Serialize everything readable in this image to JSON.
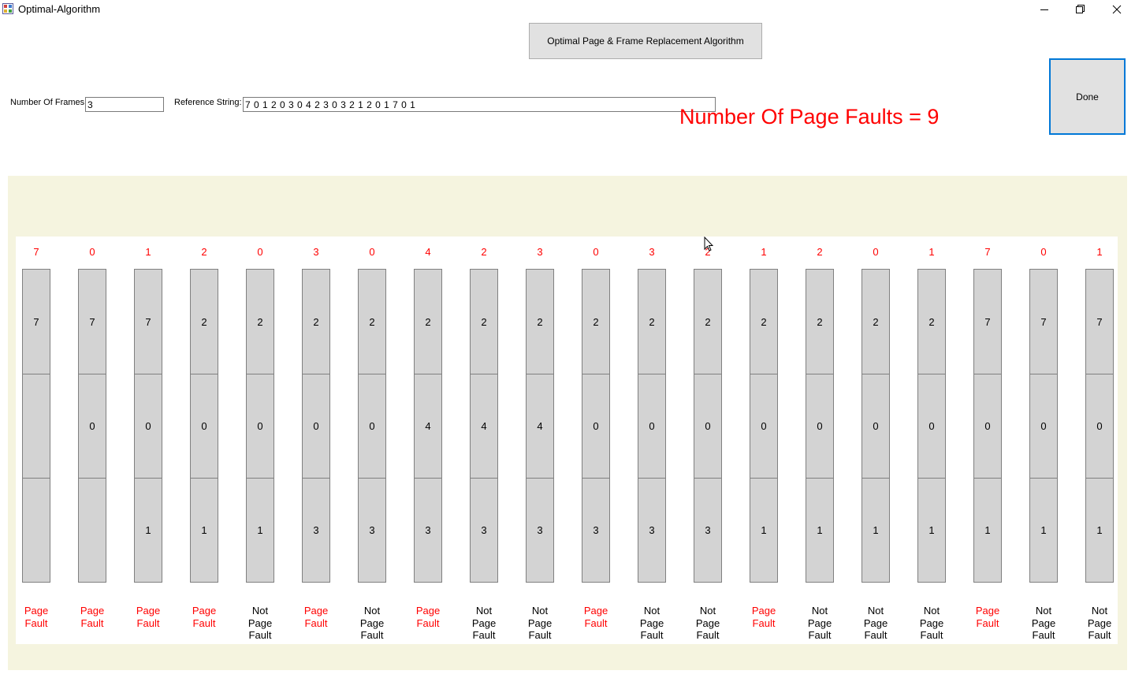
{
  "window": {
    "title": "Optimal-Algorithm"
  },
  "header": {
    "button_label": "Optimal Page & Frame Replacement Algorithm"
  },
  "inputs": {
    "frames_label": "Number Of Frames:",
    "frames_value": "3",
    "ref_label": "Reference String:",
    "ref_value": "7 0 1 2 0 3 0 4 2 3 0 3 2 1 2 0 1 7 0 1"
  },
  "done_label": "Done",
  "faults_text": "Number Of Page Faults = 9",
  "colors": {
    "fault": "#ff0000",
    "hit": "#000000",
    "panel_bg": "#f5f4df",
    "frame_bg": "#d3d3d3",
    "accent": "#0078d7"
  },
  "columns": [
    {
      "ref": "7",
      "frames": [
        "7",
        "",
        ""
      ],
      "status": "Page\nFault",
      "fault": true
    },
    {
      "ref": "0",
      "frames": [
        "7",
        "0",
        ""
      ],
      "status": "Page\nFault",
      "fault": true
    },
    {
      "ref": "1",
      "frames": [
        "7",
        "0",
        "1"
      ],
      "status": "Page\nFault",
      "fault": true
    },
    {
      "ref": "2",
      "frames": [
        "2",
        "0",
        "1"
      ],
      "status": "Page\nFault",
      "fault": true
    },
    {
      "ref": "0",
      "frames": [
        "2",
        "0",
        "1"
      ],
      "status": "Not\nPage\nFault",
      "fault": false
    },
    {
      "ref": "3",
      "frames": [
        "2",
        "0",
        "3"
      ],
      "status": "Page\nFault",
      "fault": true
    },
    {
      "ref": "0",
      "frames": [
        "2",
        "0",
        "3"
      ],
      "status": "Not\nPage\nFault",
      "fault": false
    },
    {
      "ref": "4",
      "frames": [
        "2",
        "4",
        "3"
      ],
      "status": "Page\nFault",
      "fault": true
    },
    {
      "ref": "2",
      "frames": [
        "2",
        "4",
        "3"
      ],
      "status": "Not\nPage\nFault",
      "fault": false
    },
    {
      "ref": "3",
      "frames": [
        "2",
        "4",
        "3"
      ],
      "status": "Not\nPage\nFault",
      "fault": false
    },
    {
      "ref": "0",
      "frames": [
        "2",
        "0",
        "3"
      ],
      "status": "Page\nFault",
      "fault": true
    },
    {
      "ref": "3",
      "frames": [
        "2",
        "0",
        "3"
      ],
      "status": "Not\nPage\nFault",
      "fault": false
    },
    {
      "ref": "2",
      "frames": [
        "2",
        "0",
        "3"
      ],
      "status": "Not\nPage\nFault",
      "fault": false
    },
    {
      "ref": "1",
      "frames": [
        "2",
        "0",
        "1"
      ],
      "status": "Page\nFault",
      "fault": true
    },
    {
      "ref": "2",
      "frames": [
        "2",
        "0",
        "1"
      ],
      "status": "Not\nPage\nFault",
      "fault": false
    },
    {
      "ref": "0",
      "frames": [
        "2",
        "0",
        "1"
      ],
      "status": "Not\nPage\nFault",
      "fault": false
    },
    {
      "ref": "1",
      "frames": [
        "2",
        "0",
        "1"
      ],
      "status": "Not\nPage\nFault",
      "fault": false
    },
    {
      "ref": "7",
      "frames": [
        "7",
        "0",
        "1"
      ],
      "status": "Page\nFault",
      "fault": true
    },
    {
      "ref": "0",
      "frames": [
        "7",
        "0",
        "1"
      ],
      "status": "Not\nPage\nFault",
      "fault": false
    },
    {
      "ref": "1",
      "frames": [
        "7",
        "0",
        "1"
      ],
      "status": "Not\nPage\nFault",
      "fault": false
    }
  ]
}
